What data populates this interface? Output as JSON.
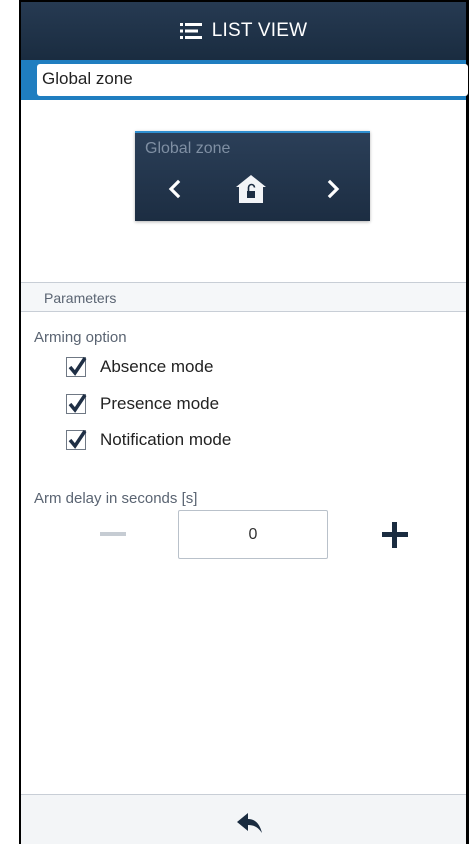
{
  "header": {
    "title": "LIST VIEW",
    "icon": "list-icon"
  },
  "zone_selector": {
    "value": "Global zone"
  },
  "zone_card": {
    "title": "Global zone",
    "status_icon": "unlocked-home-icon"
  },
  "parameters": {
    "section_title": "Parameters",
    "arming_option": {
      "label": "Arming option",
      "options": [
        {
          "label": "Absence mode",
          "checked": true
        },
        {
          "label": "Presence mode",
          "checked": true
        },
        {
          "label": "Notification mode",
          "checked": true
        }
      ]
    },
    "arm_delay": {
      "label": "Arm delay in seconds [s]",
      "value": "0"
    }
  },
  "footer": {
    "back_icon": "back-arrow-icon"
  },
  "colors": {
    "header_bg": "#1f3046",
    "accent": "#1f7ec0",
    "plus": "#1a2c40",
    "minus_disabled": "#c6ccd3"
  }
}
